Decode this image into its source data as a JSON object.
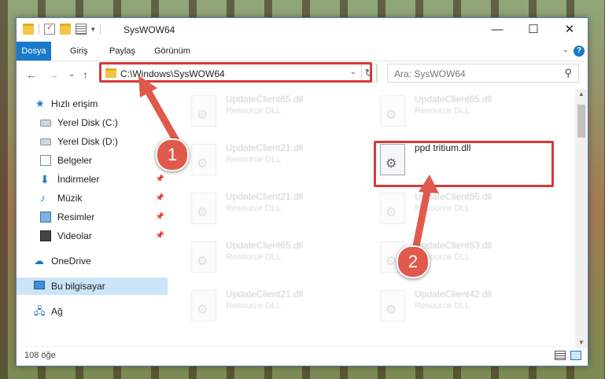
{
  "window": {
    "title": "SysWOW64",
    "controls": {
      "minimize": "—",
      "maximize": "☐",
      "close": "✕"
    }
  },
  "ribbon": {
    "tabs": [
      "Dosya",
      "Giriş",
      "Paylaş",
      "Görünüm"
    ],
    "help": "?",
    "collapse": "⌄"
  },
  "address": {
    "path": "C:\\Windows\\SysWOW64",
    "dropdown": "⌄",
    "refresh": "↻"
  },
  "search": {
    "placeholder": "Ara: SysWOW64",
    "icon": "search-icon"
  },
  "nav": {
    "back": "←",
    "forward": "→",
    "recent": "⌄",
    "up": "↑",
    "items": [
      {
        "label": "Hızlı erişim",
        "icon": "star-icon",
        "pinned": false
      },
      {
        "label": "Yerel Disk (C:)",
        "icon": "drive-icon",
        "pinned": false
      },
      {
        "label": "Yerel Disk (D:)",
        "icon": "drive-icon",
        "pinned": false
      },
      {
        "label": "Belgeler",
        "icon": "document-icon",
        "pinned": true
      },
      {
        "label": "İndirmeler",
        "icon": "download-icon",
        "pinned": true
      },
      {
        "label": "Müzik",
        "icon": "music-icon",
        "pinned": true
      },
      {
        "label": "Resimler",
        "icon": "picture-icon",
        "pinned": true
      },
      {
        "label": "Videolar",
        "icon": "video-icon",
        "pinned": true
      },
      {
        "label": "OneDrive",
        "icon": "cloud-icon",
        "pinned": false
      },
      {
        "label": "Bu bilgisayar",
        "icon": "computer-icon",
        "pinned": false,
        "selected": true
      },
      {
        "label": "Ağ",
        "icon": "network-icon",
        "pinned": false
      }
    ]
  },
  "files": [
    {
      "name": "UpdateClient65.dll",
      "type": "Resource DLL"
    },
    {
      "name": "UpdateClient65.dll",
      "type": "Resource DLL"
    },
    {
      "name": "UpdateClient21.dll",
      "type": "Resource DLL"
    },
    {
      "name": "ppd tritium.dll",
      "type": "",
      "highlighted": true
    },
    {
      "name": "UpdateClient21.dll",
      "type": "Resource DLL"
    },
    {
      "name": "UpdateClient65.dll",
      "type": "Resource DLL"
    },
    {
      "name": "UpdateClient65.dll",
      "type": "Resource DLL"
    },
    {
      "name": "UpdateClient63.dll",
      "type": "Resource DLL"
    },
    {
      "name": "UpdateClient21.dll",
      "type": "Resource DLL"
    },
    {
      "name": "UpdateClient42.dll",
      "type": "Resource DLL"
    }
  ],
  "status": {
    "item_count": "108 öğe"
  },
  "annotations": {
    "callout_1": "1",
    "callout_2": "2",
    "accent_color": "#e05a4b"
  }
}
